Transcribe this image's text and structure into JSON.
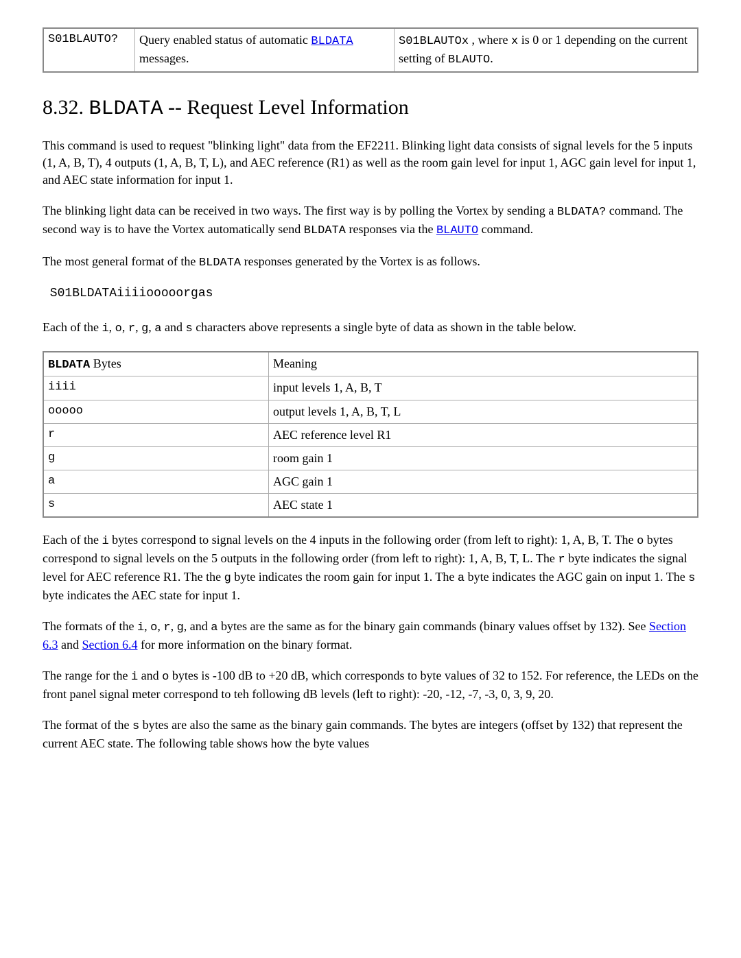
{
  "top_table": {
    "col1": "S01BLAUTO?",
    "col2_pre": "Query enabled status of automatic ",
    "col2_link": "BLDATA",
    "col2_post": " messages.",
    "col3_t1": "S01BLAUTOx",
    "col3_t2": " , where ",
    "col3_t3": "x",
    "col3_t4": " is 0 or 1 depending on the current setting of ",
    "col3_t5": "BLAUTO",
    "col3_t6": "."
  },
  "heading": {
    "num": "8.32. ",
    "code": "BLDATA",
    "rest": " -- Request Level Information"
  },
  "p1": "This command is used to request \"blinking light\" data from the EF2211. Blinking light data consists of signal levels for the 5 inputs (1, A, B, T), 4 outputs (1, A, B, T, L), and AEC reference (R1) as well as the room gain level for input 1, AGC gain level for input 1, and AEC state information for input 1.",
  "p2": {
    "t1": "The blinking light data can be received in two ways. The first way is by polling the Vortex by sending a ",
    "c1": "BLDATA?",
    "t2": " command. The second way is to have the Vortex automatically send ",
    "c2": "BLDATA",
    "t3": " responses via the ",
    "link": "BLAUTO",
    "t4": " command."
  },
  "p3": {
    "t1": "The most general format of the ",
    "c1": "BLDATA",
    "t2": " responses generated by the Vortex is as follows."
  },
  "codeblock": " S01BLDATAiiiiooooorgas",
  "p4": {
    "t1": "Each of the ",
    "c1": "i",
    "t2": ", ",
    "c2": "o",
    "t3": ", ",
    "c3": "r",
    "t4": ", ",
    "c4": "g",
    "t5": ", ",
    "c5": "a",
    "t6": " and ",
    "c6": "s",
    "t7": " characters above represents a single byte of data as shown in the table below."
  },
  "bytes_table": {
    "h1_bold": "BLDATA",
    "h1_rest": " Bytes",
    "h2": "Meaning",
    "rows": [
      {
        "b": "iiii",
        "m": "input levels 1, A, B, T"
      },
      {
        "b": "ooooo",
        "m": "output levels 1, A, B, T, L"
      },
      {
        "b": "r",
        "m": "AEC reference level R1"
      },
      {
        "b": "g",
        "m": "room gain 1"
      },
      {
        "b": "a",
        "m": "AGC gain 1"
      },
      {
        "b": "s",
        "m": "AEC state 1"
      }
    ]
  },
  "p5": {
    "t1": "Each of the ",
    "c1": "i",
    "t2": " bytes correspond to signal levels on the 4 inputs in the following order (from left to right): 1, A, B, T. The ",
    "c2": "o",
    "t3": " bytes correspond to signal levels on the 5 outputs in the following order (from left to right): 1, A, B, T, L. The ",
    "c3": "r",
    "t4": " byte indicates the signal level for AEC reference R1. The the ",
    "c4": "g",
    "t5": " byte indicates the room gain for input 1. The ",
    "c5": "a",
    "t6": " byte indicates the AGC gain on input 1. The ",
    "c6": "s",
    "t7": " byte indicates the AEC state for input 1."
  },
  "p6": {
    "t1": "The formats of the ",
    "c1": "i",
    "t2": ", ",
    "c2": "o",
    "t3": ", ",
    "c3": "r",
    "t4": ", ",
    "c4": "g",
    "t5": ", and ",
    "c5": "a",
    "t6": " bytes are the same as for the binary gain commands (binary values offset by 132). See ",
    "link1": "Section 6.3",
    "t7": " and ",
    "link2": "Section 6.4",
    "t8": " for more information on the binary format."
  },
  "p7": {
    "t1": "The range for the ",
    "c1": "i",
    "t2": " and ",
    "c2": "o",
    "t3": " bytes is -100 dB to +20 dB, which corresponds to byte values of 32 to 152. For reference, the LEDs on the front panel signal meter correspond to teh following dB levels (left to right): -20, -12, -7, -3, 0, 3, 9, 20."
  },
  "p8": {
    "t1": "The format of the ",
    "c1": "s",
    "t2": " bytes are also the same as the binary gain commands. The bytes are integers (offset by 132) that represent the current AEC state. The following table shows how the byte values"
  }
}
